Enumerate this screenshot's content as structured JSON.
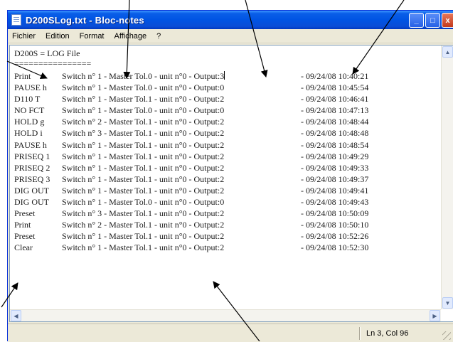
{
  "window": {
    "title": "D200SLog.txt - Bloc-notes",
    "buttons": {
      "minimize": "_",
      "maximize": "□",
      "close": "x"
    }
  },
  "menu": [
    "Fichier",
    "Edition",
    "Format",
    "Affichage",
    "?"
  ],
  "document": {
    "header": "D200S = LOG File",
    "separator": "================",
    "rows": [
      [
        "Print",
        "Switch n° 1 - Master Tol.0 - unit n°0 - Output:3",
        "- 09/24/08 10:40:21"
      ],
      [
        "PAUSE h",
        "Switch n° 1 - Master Tol.0 - unit n°0 - Output:0",
        "- 09/24/08 10:45:54"
      ],
      [
        "D110 T",
        "Switch n° 1 - Master Tol.1 - unit n°0 - Output:2",
        "- 09/24/08 10:46:41"
      ],
      [
        "NO FCT",
        "Switch n° 1 - Master Tol.0 - unit n°0 - Output:0",
        "- 09/24/08 10:47:13"
      ],
      [
        "HOLD g",
        "Switch n° 2 - Master Tol.1 - unit n°0 - Output:2",
        "- 09/24/08 10:48:44"
      ],
      [
        "HOLD i",
        "Switch n° 3 - Master Tol.1 - unit n°0 - Output:2",
        "- 09/24/08 10:48:48"
      ],
      [
        "PAUSE h",
        "Switch n° 1 - Master Tol.1 - unit n°0 - Output:2",
        "- 09/24/08 10:48:54"
      ],
      [
        "PRISEQ 1",
        "Switch n° 1 - Master Tol.1 - unit n°0 - Output:2",
        "- 09/24/08 10:49:29"
      ],
      [
        "PRISEQ 2",
        "Switch n° 1 - Master Tol.1 - unit n°0 - Output:2",
        "- 09/24/08 10:49:33"
      ],
      [
        "PRISEQ 3",
        "Switch n° 1 - Master Tol.1 - unit n°0 - Output:2",
        "- 09/24/08 10:49:37"
      ],
      [
        "DIG OUT",
        "Switch n° 1 - Master Tol.1 - unit n°0 - Output:2",
        "- 09/24/08 10:49:41"
      ],
      [
        "DIG OUT",
        "Switch n° 1 - Master Tol.0 - unit n°0 - Output:0",
        "- 09/24/08 10:49:43"
      ],
      [
        "Preset",
        "Switch n° 3 - Master Tol.1 - unit n°0 - Output:2",
        "- 09/24/08 10:50:09"
      ],
      [
        "Print",
        "Switch n° 2 - Master Tol.1 - unit n°0 - Output:2",
        "- 09/24/08 10:50:10"
      ],
      [
        "Preset",
        "Switch n° 1 - Master Tol.1 - unit n°0 - Output:2",
        "- 09/24/08 10:52:26"
      ],
      [
        "Clear",
        "Switch n° 1 - Master Tol.1 - unit n°0 - Output:2",
        "- 09/24/08 10:52:30"
      ]
    ]
  },
  "status": {
    "position": "Ln 3, Col 96"
  },
  "colors": {
    "titlebar": "#0054e3",
    "chrome": "#ece9d8",
    "arrow": "#000000"
  },
  "icons": [
    "notepad-icon",
    "minimize-icon",
    "maximize-icon",
    "close-icon",
    "scroll-up-icon",
    "scroll-down-icon",
    "scroll-left-icon",
    "scroll-right-icon",
    "resize-grip-icon"
  ]
}
